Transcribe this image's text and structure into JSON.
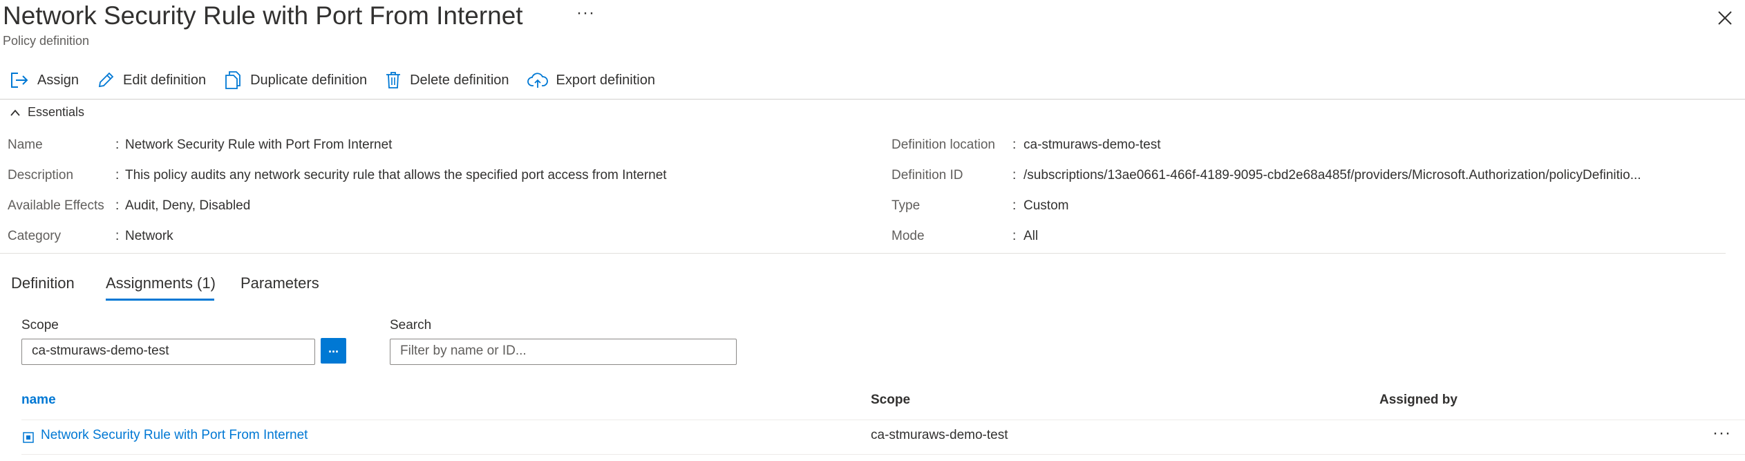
{
  "header": {
    "title": "Network Security Rule with Port From Internet",
    "more": "···",
    "subtitle": "Policy definition"
  },
  "toolbar": {
    "assign": "Assign",
    "edit": "Edit definition",
    "duplicate": "Duplicate definition",
    "delete": "Delete definition",
    "export": "Export definition"
  },
  "essentials": {
    "heading": "Essentials",
    "left": [
      {
        "label": "Name",
        "value": "Network Security Rule with Port From Internet"
      },
      {
        "label": "Description",
        "value": "This policy audits any network security rule that allows the specified port access from Internet"
      },
      {
        "label": "Available Effects",
        "value": "Audit, Deny, Disabled"
      },
      {
        "label": "Category",
        "value": "Network"
      }
    ],
    "right": [
      {
        "label": "Definition location",
        "value": "ca-stmuraws-demo-test"
      },
      {
        "label": "Definition ID",
        "value": "/subscriptions/13ae0661-466f-4189-9095-cbd2e68a485f/providers/Microsoft.Authorization/policyDefinitio..."
      },
      {
        "label": "Type",
        "value": "Custom"
      },
      {
        "label": "Mode",
        "value": "All"
      }
    ],
    "colon": ":"
  },
  "tabs": [
    {
      "label": "Definition"
    },
    {
      "label": "Assignments (1)"
    },
    {
      "label": "Parameters"
    }
  ],
  "filters": {
    "scope_label": "Scope",
    "scope_value": "ca-stmuraws-demo-test",
    "scope_button": "...",
    "search_label": "Search",
    "search_placeholder": "Filter by name or ID..."
  },
  "table": {
    "headers": [
      "name",
      "Scope",
      "Assigned by"
    ],
    "rows": [
      {
        "name": "Network Security Rule with Port From Internet",
        "scope": "ca-stmuraws-demo-test",
        "assigned_by": "",
        "more": "···"
      }
    ]
  },
  "colors": {
    "accent": "#0078d4",
    "text": "#323130",
    "muted": "#605e5c"
  },
  "icons": [
    "assign-icon",
    "edit-icon",
    "copy-icon",
    "trash-icon",
    "upload-cloud-icon",
    "chevron-up-icon",
    "close-icon",
    "policy-assignment-icon"
  ]
}
